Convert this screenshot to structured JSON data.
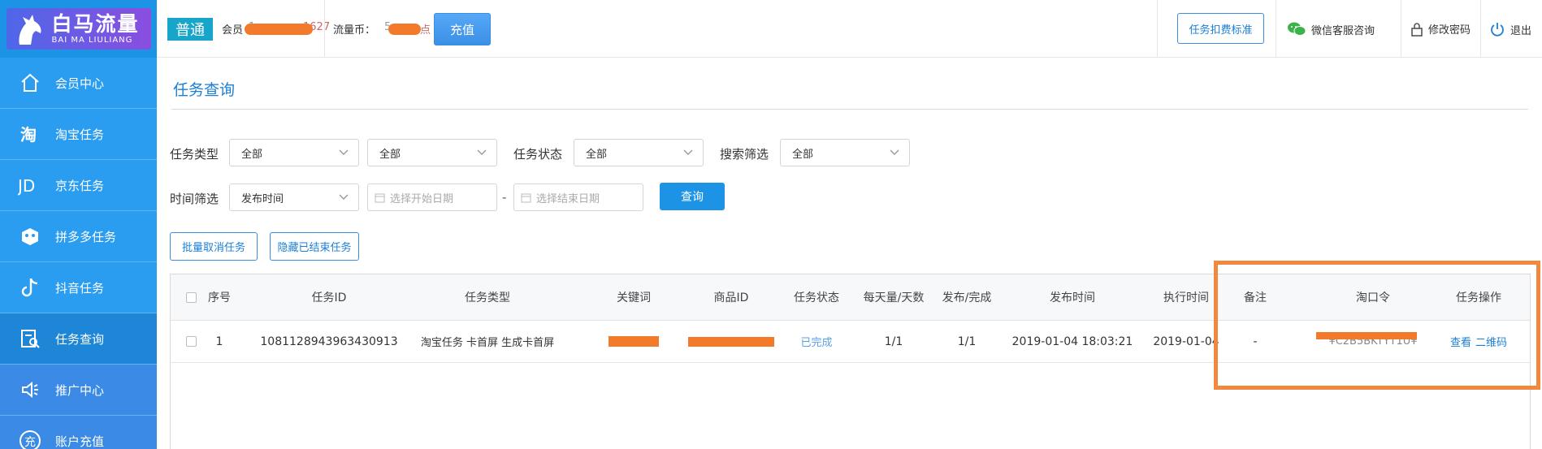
{
  "brand": {
    "name_cn": "白马流量",
    "name_en": "BAI MA LIULIANG"
  },
  "sidebar": {
    "items": [
      {
        "label": "会员中心",
        "icon": "home-icon"
      },
      {
        "label": "淘宝任务",
        "icon": "taobao-icon"
      },
      {
        "label": "京东任务",
        "icon": "jd-icon"
      },
      {
        "label": "拼多多任务",
        "icon": "pinduoduo-icon"
      },
      {
        "label": "抖音任务",
        "icon": "douyin-icon"
      },
      {
        "label": "任务查询",
        "icon": "task-search-icon"
      },
      {
        "label": "推广中心",
        "icon": "speaker-icon"
      },
      {
        "label": "账户充值",
        "icon": "recharge-icon"
      }
    ]
  },
  "header": {
    "level": "普通",
    "member_label": "会员",
    "member_value_visible": "1",
    "member_value_tail": "1627",
    "coin_label": "流量币：",
    "coin_value_head": "5",
    "coin_value_tail": "点",
    "recharge": "充值",
    "fee_standard": "任务扣费标准",
    "wechat": "微信客服咨询",
    "change_password": "修改密码",
    "logout": "退出"
  },
  "page": {
    "title": "任务查询"
  },
  "filters": {
    "task_type_label": "任务类型",
    "task_type_value": "全部",
    "task_subtype_value": "全部",
    "status_label": "任务状态",
    "status_value": "全部",
    "search_label": "搜索筛选",
    "search_value": "全部",
    "time_label": "时间筛选",
    "time_value": "发布时间",
    "start_placeholder": "选择开始日期",
    "dash": "-",
    "end_placeholder": "选择结束日期",
    "query": "查询"
  },
  "actions": {
    "batch_cancel": "批量取消任务",
    "hide_finished": "隐藏已结束任务"
  },
  "table": {
    "columns": [
      "序号",
      "任务ID",
      "任务类型",
      "关键词",
      "商品ID",
      "任务状态",
      "每天量/天数",
      "发布/完成",
      "发布时间",
      "执行时间",
      "备注",
      "淘口令",
      "任务操作"
    ],
    "rows": [
      {
        "index": "1",
        "task_id": "1081128943963430913",
        "type": "淘宝任务 卡首屏 生成卡首屏",
        "status": "已完成",
        "daily": "1/1",
        "progress": "1/1",
        "publish_time": "2019-01-04 18:03:21",
        "exec_time": "2019-01-04",
        "remark": "-",
        "tkl": "¥C2B5BKTYT1U¥",
        "op_view": "查看",
        "op_qr": "二维码"
      }
    ]
  },
  "colors": {
    "primary": "#1d93e6",
    "sidebar": "#2a9df0",
    "highlight": "#f0883e",
    "redaction": "#f27a2a"
  }
}
